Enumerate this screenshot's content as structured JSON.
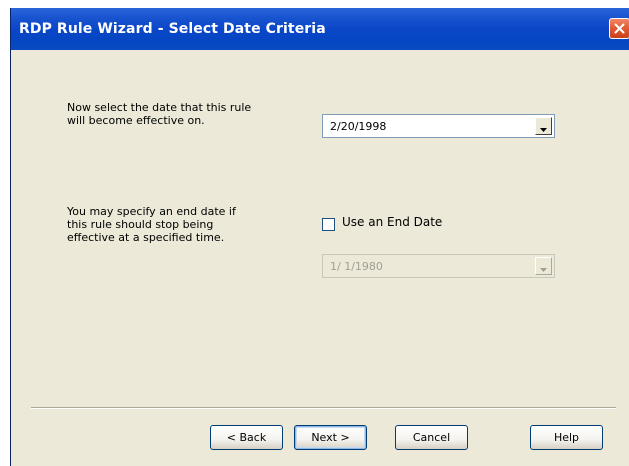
{
  "window": {
    "title": "RDP Rule Wizard - Select Date Criteria"
  },
  "effective": {
    "prompt_line1": "Now select the date that this rule",
    "prompt_line2": "will become effective on.",
    "date_value": "2/20/1998"
  },
  "end": {
    "prompt_line1": "You may specify an end date if",
    "prompt_line2": "this rule should stop being",
    "prompt_line3": "effective at a specified time.",
    "checkbox_label": "Use an End Date",
    "checked": false,
    "date_value": "1/ 1/1980",
    "enabled": false
  },
  "buttons": {
    "back": "< Back",
    "next": "Next >",
    "cancel": "Cancel",
    "help": "Help"
  },
  "icons": {
    "close": "close-icon",
    "dropdown": "chevron-down-icon"
  },
  "colors": {
    "titlebar": "#0a46c8",
    "dialog_bg": "#ece9d8",
    "close_button": "#e45c37"
  }
}
